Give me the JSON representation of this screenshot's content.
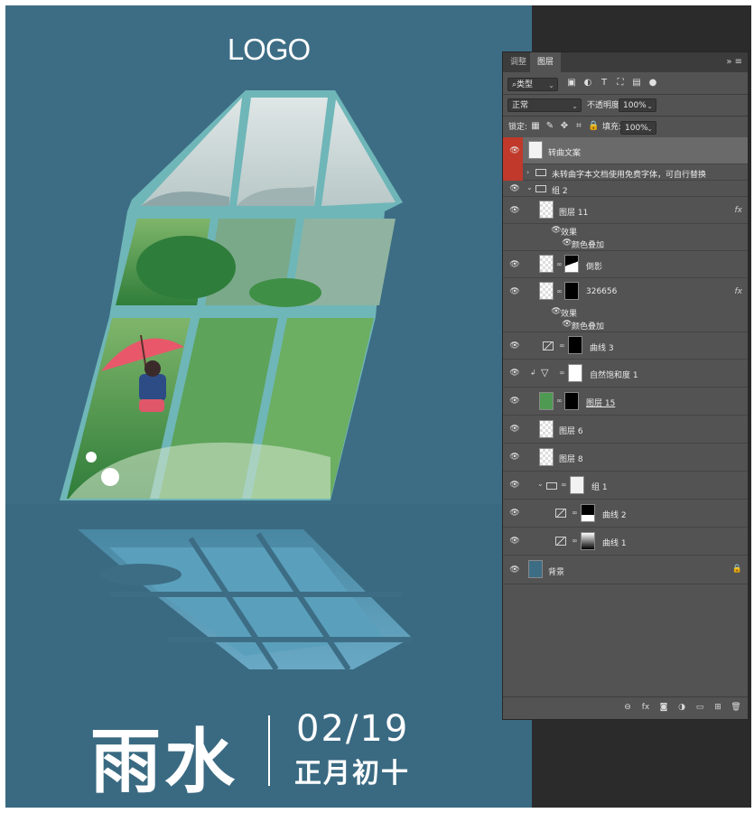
{
  "poster": {
    "logo": "LOGO",
    "title": "雨水",
    "date": "02/19",
    "lunar_date": "正月初十",
    "colors": {
      "background": "#3d6d85",
      "text": "#ffffff"
    }
  },
  "layers_panel": {
    "tabs": [
      {
        "label": "调整"
      },
      {
        "label": "图层"
      }
    ],
    "active_tab": "图层",
    "filter_select": "类型",
    "blend_mode": "正常",
    "opacity_label": "不透明度:",
    "opacity_value": "100%",
    "lock_label": "锁定:",
    "fill_label": "填充:",
    "fill_value": "100%",
    "layers": [
      {
        "name": "转曲文案"
      },
      {
        "name": "未转曲字本文档使用免费字体，可自行替换"
      },
      {
        "name": "组 2"
      },
      {
        "name": "图层 11",
        "fx": "fx"
      },
      {
        "name": "效果"
      },
      {
        "name": "颜色叠加"
      },
      {
        "name": "倒影"
      },
      {
        "name": "326656",
        "fx": "fx"
      },
      {
        "name": "效果"
      },
      {
        "name": "颜色叠加"
      },
      {
        "name": "曲线 3"
      },
      {
        "name": "自然饱和度 1"
      },
      {
        "name": "图层 15"
      },
      {
        "name": "图层 6"
      },
      {
        "name": "图层 8"
      },
      {
        "name": "组 1"
      },
      {
        "name": "曲线 2"
      },
      {
        "name": "曲线 1"
      },
      {
        "name": "背景"
      }
    ]
  }
}
